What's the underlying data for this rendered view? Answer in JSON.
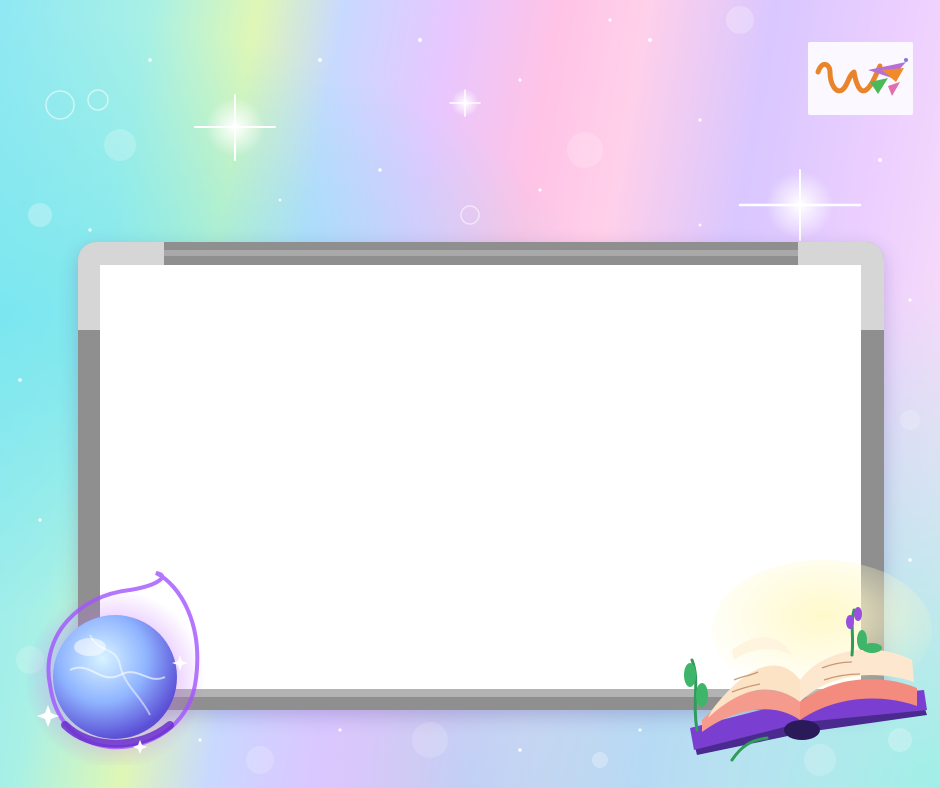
{
  "scene": {
    "background_icon": "rainbow-pastel-sparkle-background",
    "board_icon": "whiteboard-icon",
    "logo_icon": "w-logo-with-pennants-icon",
    "orb_icon": "magic-crystal-orb-icon",
    "book_icon": "open-magic-book-icon"
  },
  "colors": {
    "board_fill": "#ffffff",
    "frame_gray": "#8f8f8f",
    "frame_light": "#d6d6d6",
    "logo_orange": "#e9842a",
    "logo_purple": "#b76fd6",
    "logo_green": "#4bb85a"
  }
}
